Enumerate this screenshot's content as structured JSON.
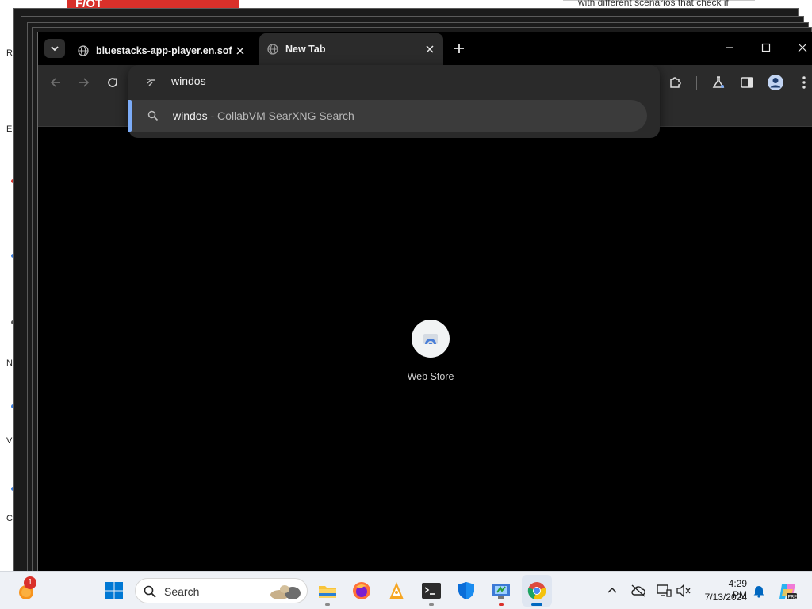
{
  "background": {
    "top_right_text": "with different scenarios that check if",
    "red_banner_text": "F/OT",
    "left_edge_chars": [
      "R",
      "E",
      "N",
      "V",
      "C"
    ]
  },
  "browser": {
    "tabs": [
      {
        "title": "bluestacks-app-player.en.softonic.com",
        "active": false
      },
      {
        "title": "New Tab",
        "active": true
      }
    ],
    "omnibox": {
      "input_value": "windos",
      "suggestion_query": "windos",
      "suggestion_separator": " - ",
      "suggestion_engine": "CollabVM SearXNG Search"
    },
    "shortcuts": [
      {
        "label": "Web Store",
        "icon": "chrome-web-store-icon"
      }
    ]
  },
  "taskbar": {
    "search_placeholder": "Search",
    "notification_badge": "1",
    "clock": {
      "time": "4:29 PM",
      "date": "7/13/2024"
    },
    "apps": [
      "file-explorer-icon",
      "firefox-icon",
      "bluestacks-icon",
      "terminal-icon",
      "windows-security-icon",
      "control-panel-icon",
      "chrome-icon"
    ]
  },
  "colors": {
    "accent": "#7cacf8",
    "window_bg": "#000000",
    "toolbar_bg": "#2b2b2b",
    "taskbar_bg": "#eef1f6",
    "windows_blue": "#0078d4"
  }
}
